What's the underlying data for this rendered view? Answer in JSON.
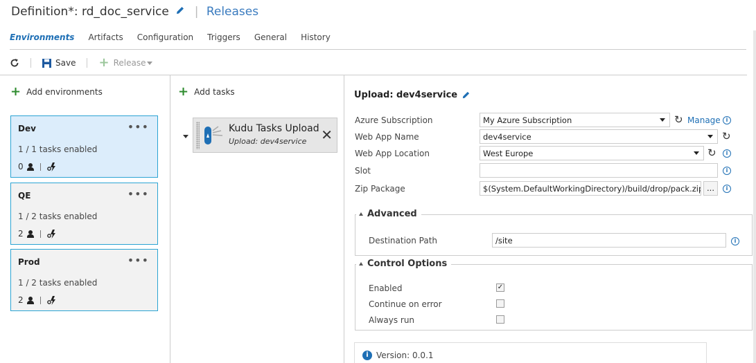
{
  "header": {
    "definition_title": "Definition*: rd_doc_service",
    "releases_link": "Releases"
  },
  "tabs": [
    {
      "label": "Environments",
      "active": true
    },
    {
      "label": "Artifacts"
    },
    {
      "label": "Configuration"
    },
    {
      "label": "Triggers"
    },
    {
      "label": "General"
    },
    {
      "label": "History"
    }
  ],
  "toolbar": {
    "save_label": "Save",
    "release_label": "Release"
  },
  "environments": {
    "add_label": "Add environments",
    "items": [
      {
        "name": "Dev",
        "tasks": "1 / 1 tasks enabled",
        "approvers": "0"
      },
      {
        "name": "QE",
        "tasks": "1 / 2 tasks enabled",
        "approvers": "2"
      },
      {
        "name": "Prod",
        "tasks": "1 / 2 tasks enabled",
        "approvers": "2"
      }
    ]
  },
  "tasks": {
    "add_label": "Add tasks",
    "items": [
      {
        "title": "Kudu Tasks Upload",
        "subtitle": "Upload: dev4service"
      }
    ]
  },
  "detail": {
    "title": "Upload: dev4service",
    "fields": {
      "azure_subscription": {
        "label": "Azure Subscription",
        "value": "My Azure Subscription",
        "manage_link": "Manage"
      },
      "web_app_name": {
        "label": "Web App Name",
        "value": "dev4service"
      },
      "web_app_location": {
        "label": "Web App Location",
        "value": "West Europe"
      },
      "slot": {
        "label": "Slot",
        "value": ""
      },
      "zip_package": {
        "label": "Zip Package",
        "value": "$(System.DefaultWorkingDirectory)/build/drop/pack.zip",
        "browse": "..."
      }
    },
    "advanced": {
      "legend": "Advanced",
      "destination_path": {
        "label": "Destination Path",
        "value": "/site"
      }
    },
    "control_options": {
      "legend": "Control Options",
      "enabled": {
        "label": "Enabled",
        "checked": true
      },
      "continue_on_error": {
        "label": "Continue on error",
        "checked": false
      },
      "always_run": {
        "label": "Always run",
        "checked": false
      }
    },
    "version": "Version: 0.0.1"
  },
  "colors": {
    "accent": "#1e6fb5",
    "selected_env_bg": "#dcedfb",
    "env_border": "#2aa3d3",
    "add_green": "#2e8b2e"
  }
}
